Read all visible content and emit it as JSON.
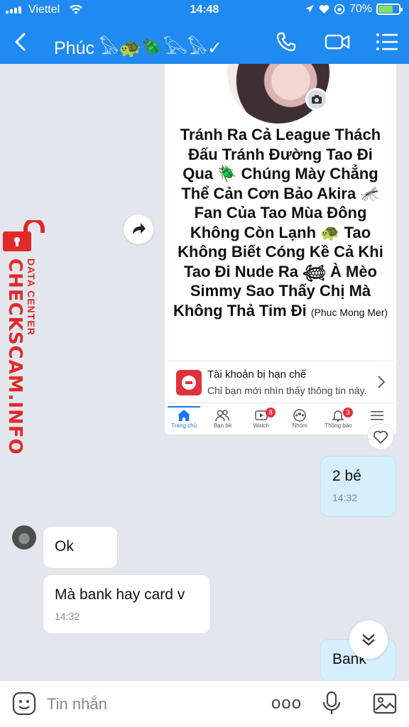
{
  "status_bar": {
    "carrier": "Viettel",
    "time": "14:48",
    "battery": "70%",
    "battery_level": 0.7
  },
  "header": {
    "title": "Phúc 𓅃🐢🪲𓅂𓅃✓"
  },
  "watermark": {
    "main": "CHECKSCAM.INFO",
    "sub": "DATA CENTER"
  },
  "shared_post": {
    "text": "Tránh Ra Cả League Thách Đấu Tránh Đường Tao Đi Qua 🪲 Chúng Mày Chẳng Thể Cản Cơn Bảo Akira 🦟 Fan Của Tao Mùa Đông Không Còn Lạnh 🐢 Tao Không Biết Cóng Kề Cả Khi Tao Đi Nude Ra 𓆉 À Mèo Simmy Sao Thấy Chị Mà Không Thả Tim Đi",
    "author_suffix": "(Phuc Mong Mer)",
    "restricted_title": "Tài khoản bị hạn chế",
    "restricted_desc": "Chỉ bạn mới nhìn thấy thông tin này.",
    "tabs": [
      {
        "label": "Trang chủ",
        "badge": ""
      },
      {
        "label": "Bạn bè",
        "badge": ""
      },
      {
        "label": "Watch",
        "badge": "8"
      },
      {
        "label": "Nhóm",
        "badge": ""
      },
      {
        "label": "Thông báo",
        "badge": "3"
      },
      {
        "label": "",
        "badge": ""
      }
    ]
  },
  "messages": [
    {
      "text": "2 bé",
      "time": "14:32"
    },
    {
      "text": "Ok"
    },
    {
      "text": "Mà bank hay card v",
      "time": "14:32"
    },
    {
      "text": "Bank"
    }
  ],
  "composer": {
    "placeholder": "Tin nhắn",
    "more": "ooo"
  },
  "colors": {
    "header": "#1f8af1",
    "outgoing_bubble": "#d5efff",
    "watermark": "#e02a2a"
  }
}
